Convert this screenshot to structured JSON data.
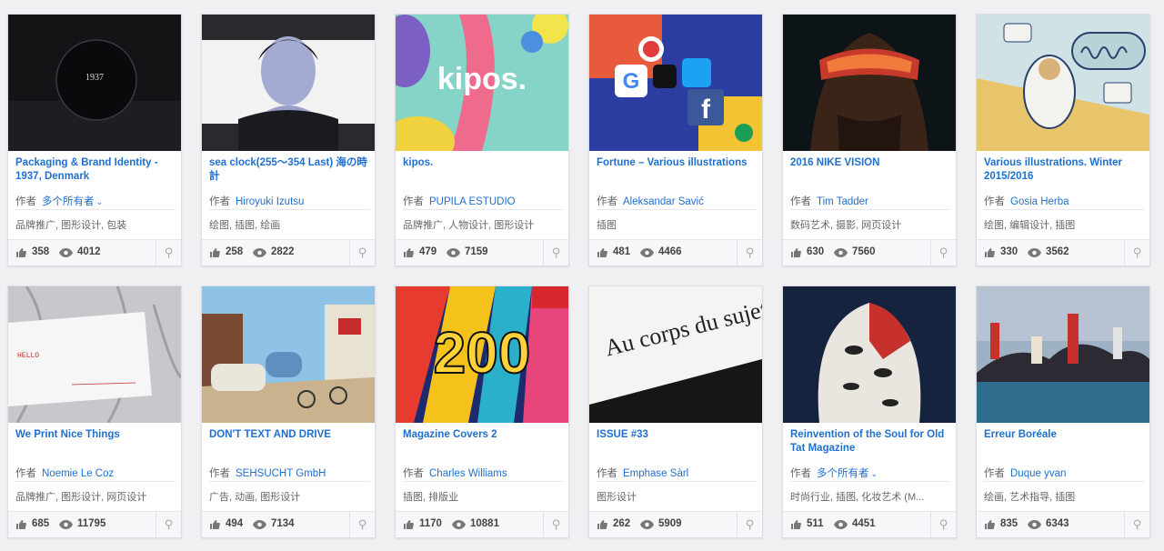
{
  "owner_prefix": "作者",
  "projects": [
    {
      "title": "Packaging & Brand Identity - 1937, Denmark",
      "owner": "多个所有者",
      "multi_owner": true,
      "categories": "品牌推广, 图形设计, 包装",
      "likes": "358",
      "views": "4012",
      "thumb_text": "1937"
    },
    {
      "title": "sea clock(255〜354 Last) 海の時計",
      "owner": "Hiroyuki Izutsu",
      "multi_owner": false,
      "categories": "绘图, 插图, 绘画",
      "likes": "258",
      "views": "2822"
    },
    {
      "title": "kipos.",
      "owner": "PUPILA ESTUDIO",
      "multi_owner": false,
      "categories": "品牌推广, 人物设计, 图形设计",
      "likes": "479",
      "views": "7159",
      "thumb_text": "kipos."
    },
    {
      "title": "Fortune – Various illustrations",
      "owner": "Aleksandar Savić",
      "multi_owner": false,
      "categories": "插图",
      "likes": "481",
      "views": "4466"
    },
    {
      "title": "2016 NIKE VISION",
      "owner": "Tim Tadder",
      "multi_owner": false,
      "categories": "数码艺术, 摄影, 网页设计",
      "likes": "630",
      "views": "7560"
    },
    {
      "title": "Various illustrations. Winter 2015/2016",
      "owner": "Gosia Herba",
      "multi_owner": false,
      "categories": "绘图, 编辑设计, 插图",
      "likes": "330",
      "views": "3562"
    },
    {
      "title": "We Print Nice Things",
      "owner": "Noemie Le Coz",
      "multi_owner": false,
      "categories": "品牌推广, 图形设计, 网页设计",
      "likes": "685",
      "views": "11795",
      "thumb_text": "HELLO"
    },
    {
      "title": "DON'T TEXT AND DRIVE",
      "owner": "SEHSUCHT GmbH",
      "multi_owner": false,
      "categories": "广告, 动画, 图形设计",
      "likes": "494",
      "views": "7134"
    },
    {
      "title": "Magazine Covers 2",
      "owner": "Charles Williams",
      "multi_owner": false,
      "categories": "插图, 排版业",
      "likes": "1170",
      "views": "10881",
      "thumb_text": "200"
    },
    {
      "title": "ISSUE #33",
      "owner": "Emphase Sàrl",
      "multi_owner": false,
      "categories": "图形设计",
      "likes": "262",
      "views": "5909",
      "thumb_text": "Au corps du sujet"
    },
    {
      "title": "Reinvention of the Soul for Old Tat Magazine",
      "owner": "多个所有者",
      "multi_owner": true,
      "categories": "时尚行业, 插图, 化妆艺术 (M...",
      "likes": "511",
      "views": "4451"
    },
    {
      "title": "Erreur Boréale",
      "owner": "Duque yvan",
      "multi_owner": false,
      "categories": "绘画, 艺术指导, 插图",
      "likes": "835",
      "views": "6343"
    }
  ],
  "colors": {
    "link": "#1f6fd0",
    "background": "#f0f0f3"
  }
}
